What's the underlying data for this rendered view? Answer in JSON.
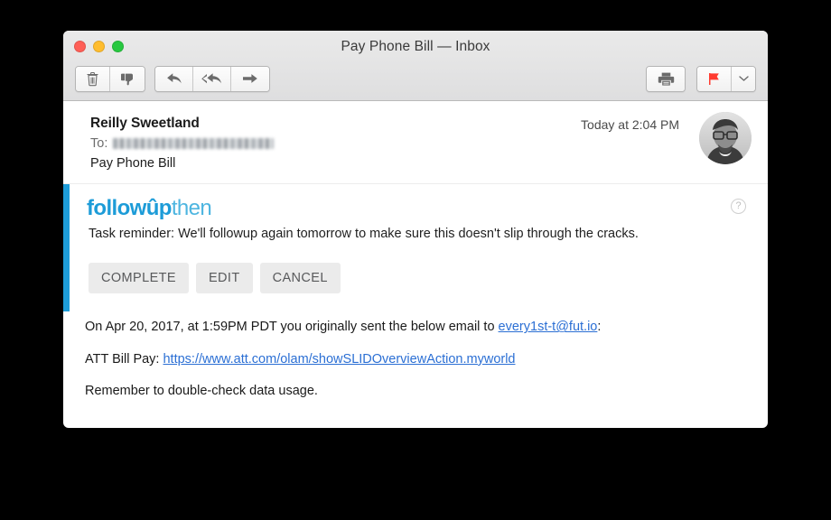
{
  "window": {
    "title": "Pay Phone Bill — Inbox",
    "traffic_lights": [
      {
        "name": "close",
        "color": "#ff5f57"
      },
      {
        "name": "minimize",
        "color": "#ffbd2e"
      },
      {
        "name": "maximize",
        "color": "#28c840"
      }
    ]
  },
  "toolbar": {
    "left_buttons": [
      {
        "name": "delete-button",
        "icon": "trash-icon"
      },
      {
        "name": "junk-button",
        "icon": "thumbs-down-icon"
      }
    ],
    "reply_buttons": [
      {
        "name": "reply-button",
        "icon": "reply-arrow-icon"
      },
      {
        "name": "reply-all-button",
        "icon": "reply-all-arrow-icon"
      },
      {
        "name": "forward-button",
        "icon": "forward-arrow-icon"
      }
    ],
    "right_buttons": [
      {
        "name": "print-button",
        "icon": "printer-icon"
      },
      {
        "name": "flag-button",
        "icon": "flag-icon",
        "color": "#ff3b30"
      },
      {
        "name": "flag-dropdown-button",
        "icon": "chevron-down-icon"
      }
    ]
  },
  "header": {
    "sender": "Reilly Sweetland",
    "to_label": "To:",
    "to_value_redacted": true,
    "subject": "Pay Phone Bill",
    "date": "Today at 2:04 PM",
    "avatar_alt": "avatar"
  },
  "fut": {
    "accent_color": "#1d9cd8",
    "logo_bold": "followûp",
    "logo_light": "then",
    "help_glyph": "?",
    "message": "Task reminder: We'll followup again tomorrow to make sure this doesn't slip through the cracks.",
    "buttons": [
      {
        "name": "complete-button",
        "label": "COMPLETE"
      },
      {
        "name": "edit-button",
        "label": "EDIT"
      },
      {
        "name": "cancel-button",
        "label": "CANCEL"
      }
    ]
  },
  "body": {
    "line1_before": "On Apr 20, 2017, at 1:59PM PDT you originally sent the below email to ",
    "line1_link": "every1st-t@fut.io",
    "line1_after": ":",
    "line2_before": "ATT Bill Pay: ",
    "line2_link": "https://www.att.com/olam/showSLIDOverviewAction.myworld",
    "line3": "Remember to double-check data usage."
  }
}
